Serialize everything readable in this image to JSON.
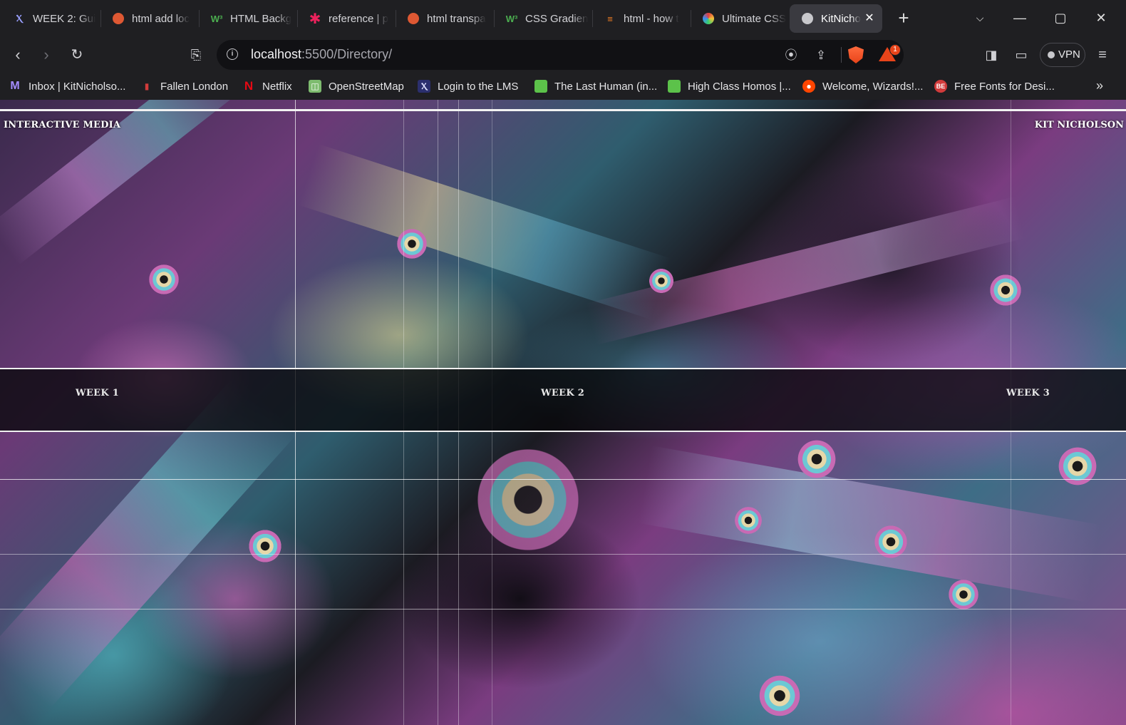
{
  "tabs": [
    {
      "title": "WEEK 2: Gui",
      "icon": "lms-icon",
      "active": false
    },
    {
      "title": "html add loc",
      "icon": "ddg-icon",
      "active": false
    },
    {
      "title": "HTML Backg",
      "icon": "w3schools-icon",
      "active": false
    },
    {
      "title": "reference | p",
      "icon": "asterisk-icon",
      "active": false
    },
    {
      "title": "html transpa",
      "icon": "ddg-icon",
      "active": false
    },
    {
      "title": "CSS Gradien",
      "icon": "w3schools-icon",
      "active": false
    },
    {
      "title": "html - how t",
      "icon": "stackoverflow-icon",
      "active": false
    },
    {
      "title": "Ultimate CSS",
      "icon": "gradient-icon",
      "active": false
    },
    {
      "title": "KitNicho",
      "icon": "globe-icon",
      "active": true
    }
  ],
  "toolbar": {
    "url_host": "localhost",
    "url_path": ":5500/Directory/",
    "vpn_label": "VPN",
    "rewards_count": "1"
  },
  "bookmarks": [
    {
      "label": "Inbox | KitNicholso...",
      "icon": "gmail-icon"
    },
    {
      "label": "Fallen London",
      "icon": "candle-icon"
    },
    {
      "label": "Netflix",
      "icon": "netflix-icon"
    },
    {
      "label": "OpenStreetMap",
      "icon": "map-icon"
    },
    {
      "label": "Login to the LMS",
      "icon": "lms-icon"
    },
    {
      "label": "The Last Human (in...",
      "icon": "ao3-icon"
    },
    {
      "label": "High Class Homos |...",
      "icon": "ao3-icon"
    },
    {
      "label": "Welcome, Wizards!...",
      "icon": "reddit-icon"
    },
    {
      "label": "Free Fonts for Desi...",
      "icon": "fonts-icon"
    }
  ],
  "page": {
    "site_title": "INTERACTIVE MEDIA",
    "author": "KIT NICHOLSON",
    "weeks": [
      "WEEK 1",
      "WEEK 2",
      "WEEK 3"
    ]
  },
  "colors": {
    "browser_bg": "#1f1f22",
    "url_bg": "#111114",
    "active_tab": "#3a3a40",
    "brave_accent": "#e8441a"
  }
}
